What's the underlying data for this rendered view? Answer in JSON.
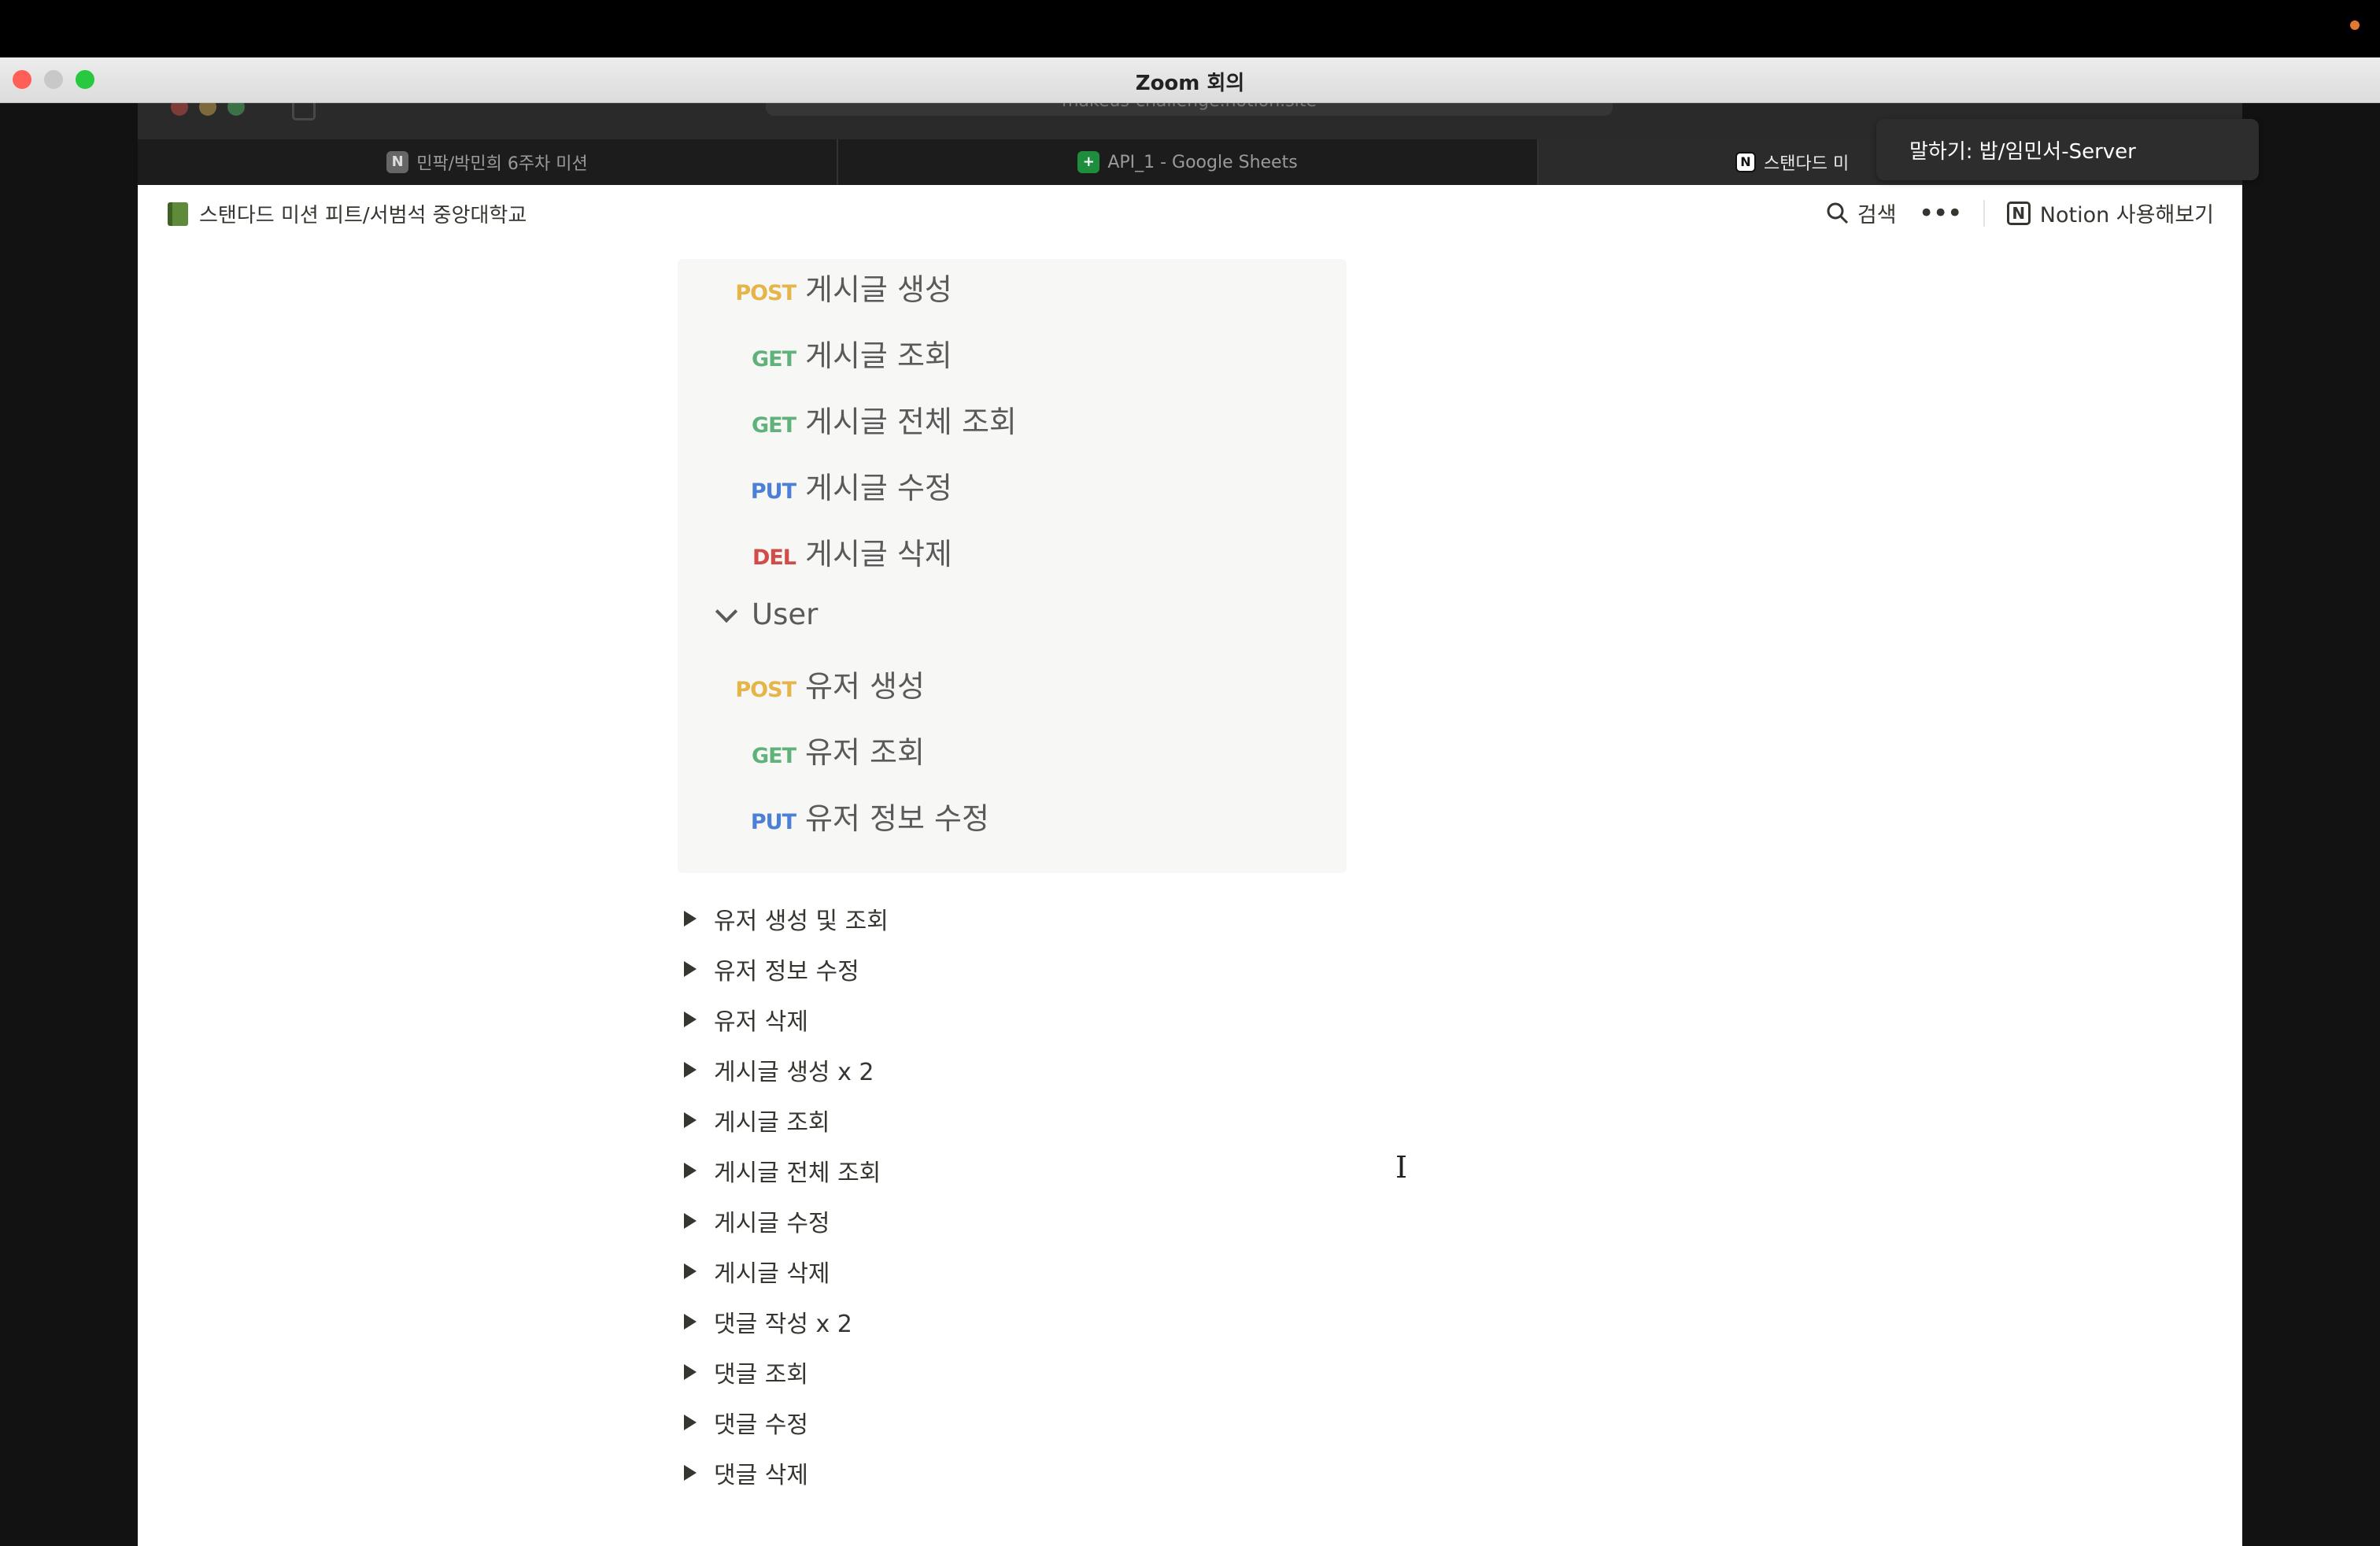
{
  "zoom": {
    "title": "Zoom 회의",
    "speaker_label": "말하기: 밥/임민서-Server",
    "traffic_colors": [
      "#ff5f57",
      "#c8c8c8",
      "#28c840"
    ]
  },
  "browser": {
    "url": "makeus-challenge.notion.site",
    "tabs": [
      {
        "label": "민팍/박민희 6주차 미션",
        "icon": "notion-icon"
      },
      {
        "label": "API_1 - Google Sheets",
        "icon": "sheets-icon"
      },
      {
        "label": "스탠다드 미",
        "icon": "notion-icon"
      }
    ]
  },
  "notion": {
    "breadcrumb": "스탠다드 미션 피트/서범석 중앙대학교",
    "search_label": "검색",
    "try_notion_label": "Notion 사용해보기",
    "endpoints": [
      {
        "method": "POST",
        "label": "게시글 생성"
      },
      {
        "method": "GET",
        "label": "게시글 조회"
      },
      {
        "method": "GET",
        "label": "게시글 전체 조회"
      },
      {
        "method": "PUT",
        "label": "게시글 수정"
      },
      {
        "method": "DEL",
        "label": "게시글 삭제"
      }
    ],
    "group_label": "User",
    "user_endpoints": [
      {
        "method": "POST",
        "label": "유저 생성"
      },
      {
        "method": "GET",
        "label": "유저 조회"
      },
      {
        "method": "PUT",
        "label": "유저 정보 수정"
      }
    ],
    "toggles": [
      "유저 생성 및 조회",
      "유저 정보 수정",
      "유저 삭제",
      "게시글 생성 x 2",
      "게시글 조회",
      "게시글 전체 조회",
      "게시글 수정",
      "게시글 삭제",
      "댓글 작성 x 2",
      "댓글 조회",
      "댓글 수정",
      "댓글 삭제"
    ]
  }
}
